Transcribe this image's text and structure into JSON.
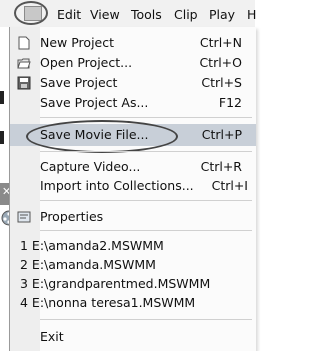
{
  "menubar": {
    "items": [
      "Edit",
      "View",
      "Tools",
      "Clip",
      "Play",
      "H"
    ]
  },
  "file_menu": {
    "new_project": {
      "label": "New Project",
      "shortcut": "Ctrl+N"
    },
    "open_project": {
      "label": "Open Project...",
      "shortcut": "Ctrl+O"
    },
    "save_project": {
      "label": "Save Project",
      "shortcut": "Ctrl+S"
    },
    "save_project_as": {
      "label": "Save Project As...",
      "shortcut": "F12"
    },
    "save_movie_file": {
      "label": "Save Movie File...",
      "shortcut": "Ctrl+P"
    },
    "capture_video": {
      "label": "Capture Video...",
      "shortcut": "Ctrl+R"
    },
    "import_collections": {
      "label": "Import into Collections...",
      "shortcut": "Ctrl+I"
    },
    "properties": {
      "label": "Properties"
    },
    "recent": [
      "1 E:\\amanda2.MSWMM",
      "2 E:\\amanda.MSWMM",
      "3 E:\\grandparentmed.MSWMM",
      "4 E:\\nonna teresa1.MSWMM"
    ],
    "exit": {
      "label": "Exit"
    }
  },
  "icons": [
    "file-menu-icon",
    "new-project-icon",
    "open-project-icon",
    "save-project-icon",
    "properties-icon",
    "close-icon",
    "film-icon"
  ]
}
